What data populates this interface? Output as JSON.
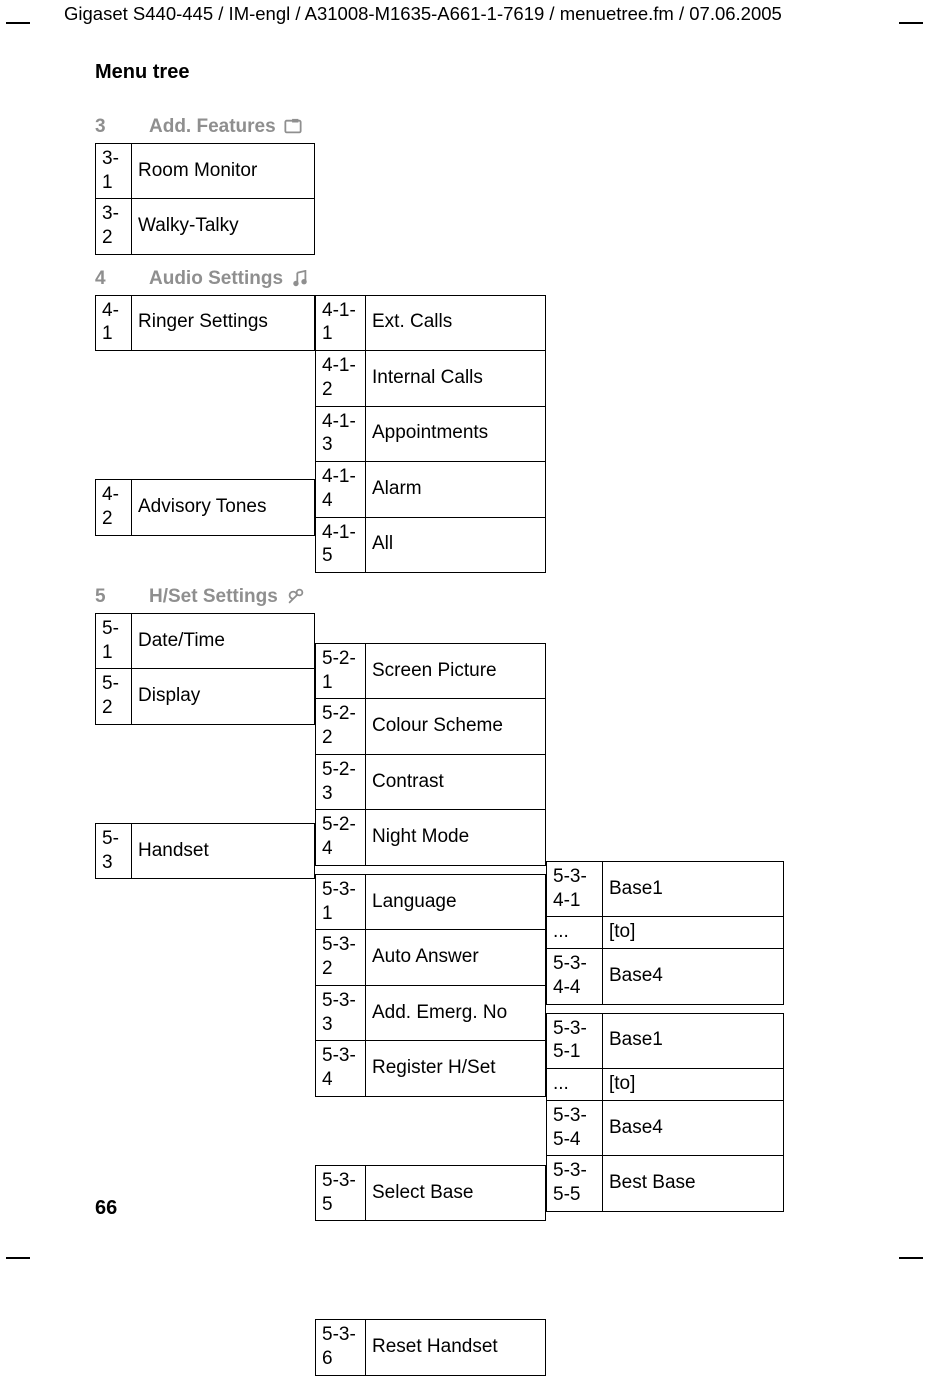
{
  "header": "Gigaset S440-445 / IM-engl / A31008-M1635-A661-1-7619 / menuetree.fm / 07.06.2005",
  "title": "Menu tree",
  "page_number": "66",
  "s3": {
    "num": "3",
    "label": "Add. Features",
    "rows": [
      {
        "id": "3-1",
        "label": "Room Monitor"
      },
      {
        "id": "3-2",
        "label": "Walky-Talky"
      }
    ]
  },
  "s4": {
    "num": "4",
    "label": "Audio Settings",
    "r1": {
      "id": "4-1",
      "label": "Ringer Settings"
    },
    "r1sub": [
      {
        "id": "4-1-1",
        "label": "Ext. Calls"
      },
      {
        "id": "4-1-2",
        "label": "Internal Calls"
      },
      {
        "id": "4-1-3",
        "label": "Appointments"
      },
      {
        "id": "4-1-4",
        "label": "Alarm"
      },
      {
        "id": "4-1-5",
        "label": "All"
      }
    ],
    "r2": {
      "id": "4-2",
      "label": "Advisory Tones"
    }
  },
  "s5": {
    "num": "5",
    "label": "H/Set Settings",
    "r1": {
      "id": "5-1",
      "label": "Date/Time"
    },
    "r2": {
      "id": "5-2",
      "label": "Display"
    },
    "r2sub": [
      {
        "id": "5-2-1",
        "label": "Screen Picture"
      },
      {
        "id": "5-2-2",
        "label": "Colour Scheme"
      },
      {
        "id": "5-2-3",
        "label": "Contrast"
      },
      {
        "id": "5-2-4",
        "label": "Night Mode"
      }
    ],
    "r3": {
      "id": "5-3",
      "label": "Handset"
    },
    "r3sub1": {
      "id": "5-3-1",
      "label": "Language"
    },
    "r3sub2": {
      "id": "5-3-2",
      "label": "Auto Answer"
    },
    "r3sub3": {
      "id": "5-3-3",
      "label": "Add. Emerg. No"
    },
    "r3sub4": {
      "id": "5-3-4",
      "label": "Register H/Set"
    },
    "r3sub4_l3": [
      {
        "id": "5-3-4-1",
        "label": "Base1"
      },
      {
        "id": "...",
        "label": "[to]"
      },
      {
        "id": "5-3-4-4",
        "label": "Base4"
      }
    ],
    "r3sub5": {
      "id": "5-3-5",
      "label": "Select Base"
    },
    "r3sub5_l3": [
      {
        "id": "5-3-5-1",
        "label": "Base1"
      },
      {
        "id": "...",
        "label": "[to]"
      },
      {
        "id": "5-3-5-4",
        "label": "Base4"
      },
      {
        "id": "5-3-5-5",
        "label": "Best Base"
      }
    ],
    "r3sub6": {
      "id": "5-3-6",
      "label": "Reset Handset"
    }
  }
}
